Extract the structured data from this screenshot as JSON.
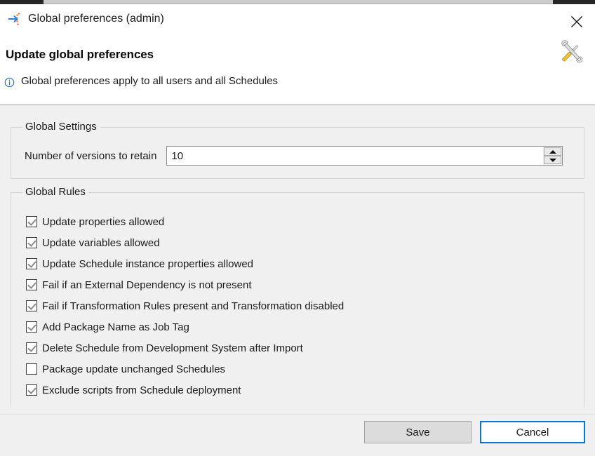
{
  "window": {
    "title": "Global preferences (admin)",
    "title_icon": "import-arrow-icon",
    "close_icon": "close-icon"
  },
  "header": {
    "page_title": "Update global preferences",
    "info_icon": "info-circle-icon",
    "info_text": "Global preferences apply to all users and all Schedules",
    "decoration_icon": "tools-wrench-screwdriver-icon"
  },
  "settings_group": {
    "legend": "Global Settings",
    "field_label": "Number of versions to retain",
    "field_value": "10",
    "spinner_up_icon": "triangle-up-icon",
    "spinner_down_icon": "triangle-down-icon"
  },
  "rules_group": {
    "legend": "Global Rules",
    "items": [
      {
        "label": "Update properties allowed",
        "checked": true
      },
      {
        "label": "Update variables allowed",
        "checked": true
      },
      {
        "label": "Update Schedule instance properties allowed",
        "checked": true
      },
      {
        "label": "Fail if an External Dependency is not present",
        "checked": true
      },
      {
        "label": "Fail if Transformation Rules present and Transformation disabled",
        "checked": true
      },
      {
        "label": "Add Package Name as Job Tag",
        "checked": true
      },
      {
        "label": "Delete Schedule from Development System after Import",
        "checked": true
      },
      {
        "label": "Package update unchanged Schedules",
        "checked": false
      },
      {
        "label": "Exclude scripts from Schedule deployment",
        "checked": true
      }
    ]
  },
  "footer": {
    "save_label": "Save",
    "cancel_label": "Cancel"
  },
  "colors": {
    "accent_blue": "#0a75d2",
    "body_background": "#f0f0f0",
    "icon_orange": "#e8622a",
    "icon_blue": "#2a7fd4"
  }
}
